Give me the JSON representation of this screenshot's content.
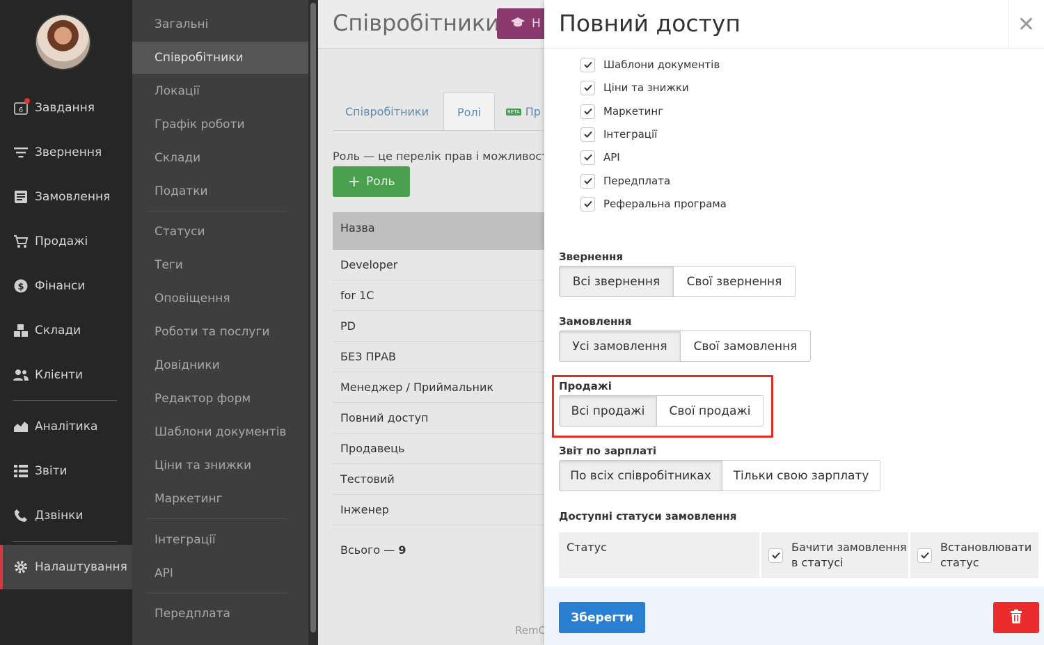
{
  "nav": {
    "items": [
      {
        "label": "Завдання",
        "icon": "calendar-icon",
        "badge_number": "6"
      },
      {
        "label": "Звернення",
        "icon": "filter-icon"
      },
      {
        "label": "Замовлення",
        "icon": "order-icon"
      },
      {
        "label": "Продажі",
        "icon": "cart-icon"
      },
      {
        "label": "Фінанси",
        "icon": "dollar-icon"
      },
      {
        "label": "Склади",
        "icon": "boxes-icon"
      },
      {
        "label": "Клієнти",
        "icon": "users-icon"
      },
      {
        "label": "Аналітика",
        "icon": "chart-icon"
      },
      {
        "label": "Звіти",
        "icon": "list-icon"
      },
      {
        "label": "Дзвінки",
        "icon": "phone-icon"
      },
      {
        "label": "Налаштування",
        "icon": "gear-icon",
        "active": true
      }
    ]
  },
  "submenu": {
    "items": [
      "Загальні",
      "Співробітники",
      "Локації",
      "Графік роботи",
      "Склади",
      "Податки",
      "Статуси",
      "Теги",
      "Оповіщення",
      "Роботи та послуги",
      "Довідники",
      "Редактор форм",
      "Шаблони документів",
      "Ціни та знижки",
      "Маркетинг",
      "Інтеграції",
      "API",
      "Передплата"
    ],
    "active": "Співробітники"
  },
  "main": {
    "title": "Співробітники",
    "help_label": "Н",
    "tabs": [
      {
        "label": "Співробітники"
      },
      {
        "label": "Ролі",
        "active": true
      },
      {
        "label": "Пр",
        "beta": "BETA"
      }
    ],
    "description": "Роль — це перелік прав і можливостей",
    "add_role_label": "Роль",
    "table_header": "Назва",
    "roles": [
      "Developer",
      "for 1C",
      "PD",
      "БЕЗ ПРАВ",
      "Менеджер / Приймальник",
      "Повний доступ",
      "Продавець",
      "Тестовий",
      "Інженер"
    ],
    "total_prefix": "Всього — ",
    "total_count": "9",
    "footer_text": "RemO"
  },
  "panel": {
    "title": "Повний доступ",
    "permissions": [
      "Шаблони документів",
      "Ціни та знижки",
      "Маркетинг",
      "Інтеграції",
      "API",
      "Передплата",
      "Реферальна програма"
    ],
    "sections": {
      "requests": {
        "label": "Звернення",
        "options": [
          "Всі звернення",
          "Свої звернення"
        ],
        "selected": "Всі звернення"
      },
      "orders": {
        "label": "Замовлення",
        "options": [
          "Усі замовлення",
          "Свої замовлення"
        ],
        "selected": "Усі замовлення"
      },
      "sales": {
        "label": "Продажі",
        "options": [
          "Всі продажі",
          "Свої продажі"
        ],
        "selected": "Всі продажі"
      },
      "salary": {
        "label": "Звіт по зарплаті",
        "options": [
          "По всіх співробітниках",
          "Тільки свою зарплату"
        ],
        "selected": "По всіх співробітниках"
      }
    },
    "statuses_title": "Доступні статуси замовлення",
    "status_table": {
      "col_status": "Статус",
      "col_view_line1": "Бачити замовлення",
      "col_view_line2": "в статусі",
      "col_set_line1": "Встановлювати",
      "col_set_line2": "статус"
    },
    "save_label": "Зберегти",
    "colors": {
      "primary": "#2a7fd0",
      "danger": "#ec2c2c",
      "highlight": "#e32b1f",
      "success": "#4aa04f"
    }
  }
}
